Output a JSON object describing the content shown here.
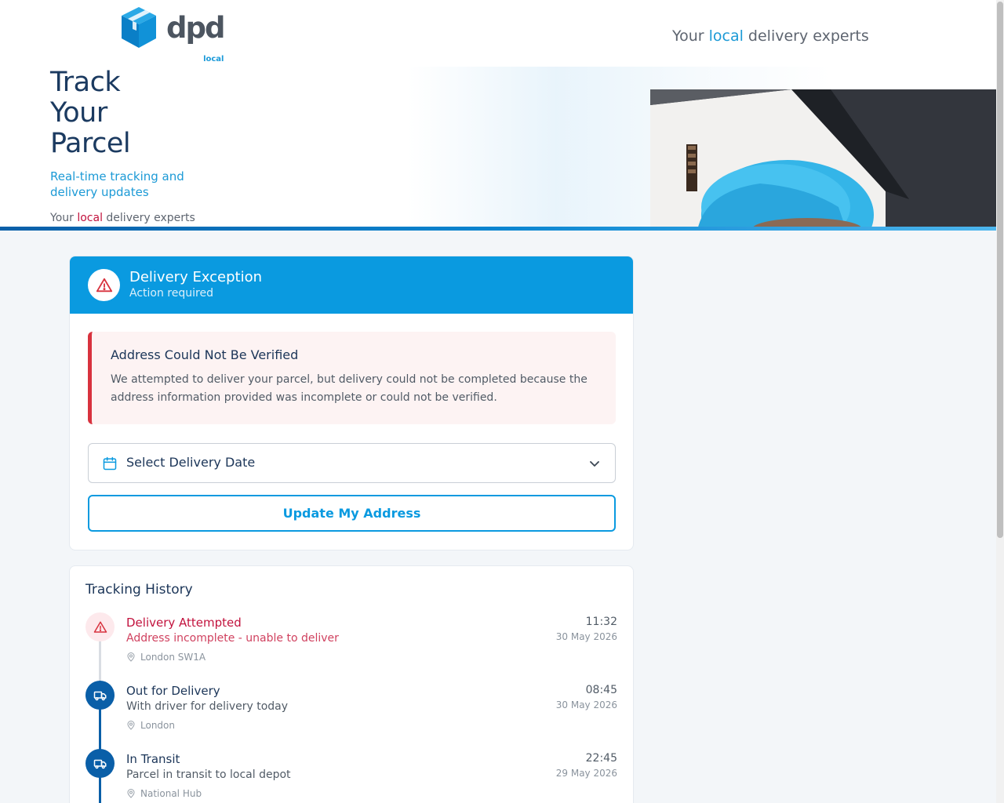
{
  "brand": {
    "logo_word": "dpd",
    "logo_sub": "local",
    "tagline_pre": "Your ",
    "tagline_hl": "local",
    "tagline_post": " delivery experts"
  },
  "hero": {
    "title_line1": "Track",
    "title_line2": "Your",
    "title_line3": "Parcel",
    "subtitle": "Real-time tracking and delivery updates",
    "foot_pre": "Your ",
    "foot_hl": "local",
    "foot_post": " delivery experts"
  },
  "exception": {
    "title": "Delivery Exception",
    "subtitle": "Action required",
    "alert_title": "Address Could Not Be Verified",
    "alert_body": "We attempted to deliver your parcel, but delivery could not be completed because the address information provided was incomplete or could not be verified.",
    "date_select_label": "Select Delivery Date",
    "update_button": "Update My Address"
  },
  "history": {
    "title": "Tracking History",
    "events": [
      {
        "status": "Delivery Attempted",
        "detail": "Address incomplete - unable to deliver",
        "location": "London SW1A",
        "time": "11:32",
        "date": "30 May 2026",
        "kind": "alert"
      },
      {
        "status": "Out for Delivery",
        "detail": "With driver for delivery today",
        "location": "London",
        "time": "08:45",
        "date": "30 May 2026",
        "kind": "truck"
      },
      {
        "status": "In Transit",
        "detail": "Parcel in transit to local depot",
        "location": "National Hub",
        "time": "22:45",
        "date": "29 May 2026",
        "kind": "truck"
      }
    ]
  },
  "colors": {
    "primary_blue": "#0a9ae0",
    "navy": "#1b3558",
    "alert_red": "#c2123d"
  }
}
